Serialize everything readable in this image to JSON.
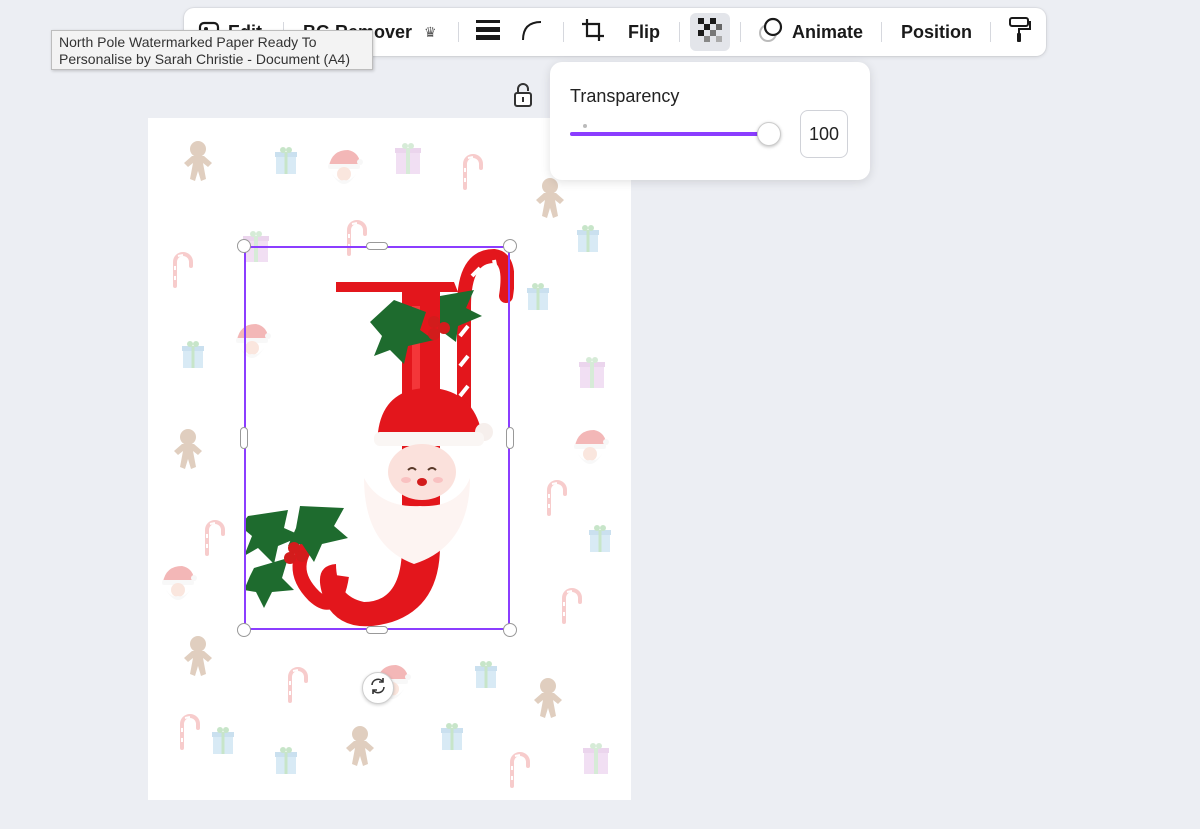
{
  "toolbar": {
    "edit_label": "Edit",
    "bg_remover_label": "BG Remover",
    "flip_label": "Flip",
    "animate_label": "Animate",
    "position_label": "Position"
  },
  "tooltip": {
    "line1": "North Pole Watermarked Paper Ready To",
    "line2": "Personalise by Sarah Christie - Document (A4)"
  },
  "transparency": {
    "title": "Transparency",
    "value": "100",
    "level_percent": 100
  },
  "colors": {
    "accent": "#8b3dff",
    "letter_red": "#e3161c",
    "holly_green": "#1e6b2e"
  }
}
